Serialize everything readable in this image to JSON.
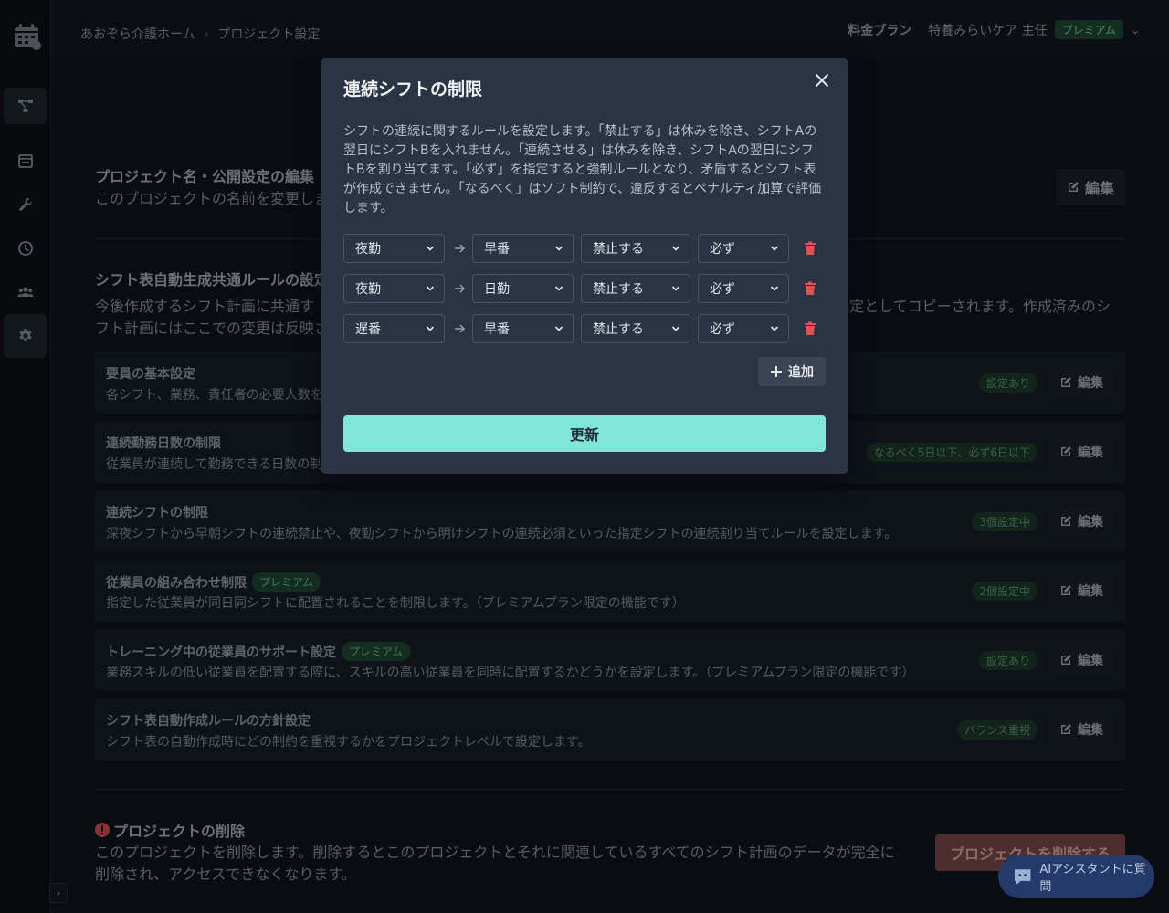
{
  "header": {
    "breadcrumb": [
      "あおぞら介護ホーム",
      "プロジェクト設定"
    ],
    "plan_link": "料金プラン",
    "user_name": "特養みらいケア 主任",
    "user_badge": "プレミアム"
  },
  "sidebar": {
    "items": [
      {
        "icon": "workflow-icon"
      },
      {
        "icon": "calendar-icon"
      },
      {
        "icon": "wrench-icon"
      },
      {
        "icon": "clock-icon"
      },
      {
        "icon": "users-icon"
      },
      {
        "icon": "gear-icon"
      }
    ],
    "toggle": "›"
  },
  "main": {
    "project_name": {
      "title": "プロジェクト名・公開設定の編集",
      "desc": "このプロジェクトの名前を変更しま",
      "edit": "編集"
    },
    "common_rules": {
      "title": "シフト表自動生成共通ルールの設定",
      "desc_left_1": "今後作成するシフト計画に共通す",
      "desc_right_1": "設定としてコピーされます。作成済みのシ",
      "desc_line_2": "フト計画にはここでの変更は反映さ"
    },
    "rules": [
      {
        "title": "要員の基本設定",
        "desc": "各シフト、業務、責任者の必要人数を",
        "status": "設定あり",
        "edit": "編集",
        "premium": ""
      },
      {
        "title": "連続勤務日数の制限",
        "desc": "従業員が連続して勤務できる日数の制",
        "status": "なるべく5日以下、必ず6日以下",
        "edit": "編集",
        "premium": ""
      },
      {
        "title": "連続シフトの制限",
        "desc": "深夜シフトから早朝シフトの連続禁止や、夜勤シフトから明けシフトの連続必須といった指定シフトの連続割り当てルールを設定します。",
        "status": "3個設定中",
        "edit": "編集",
        "premium": ""
      },
      {
        "title": "従業員の組み合わせ制限",
        "desc": "指定した従業員が同日同シフトに配置されることを制限します。（プレミアムプラン限定の機能です）",
        "status": "2個設定中",
        "edit": "編集",
        "premium": "プレミアム"
      },
      {
        "title": "トレーニング中の従業員のサポート設定",
        "desc": "業務スキルの低い従業員を配置する際に、スキルの高い従業員を同時に配置するかどうかを設定します。（プレミアムプラン限定の機能です）",
        "status": "設定あり",
        "edit": "編集",
        "premium": "プレミアム"
      },
      {
        "title": "シフト表自動作成ルールの方針設定",
        "desc": "シフト表の自動作成時にどの制約を重視するかをプロジェクトレベルで設定します。",
        "status": "バランス重視",
        "edit": "編集",
        "premium": ""
      }
    ],
    "delete": {
      "title": "プロジェクトの削除",
      "desc_1": "このプロジェクトを削除します。削除するとこのプロジェクトとそれに関連しているすべてのシフト計画のデータが完全に",
      "desc_2": "削除され、アクセスできなくなります。",
      "button": "プロジェクトを削除する"
    },
    "ai_assistant": "AIアシスタントに質問"
  },
  "modal": {
    "title": "連続シフトの制限",
    "description": "シフトの連続に関するルールを設定します。「禁止する」は休みを除き、シフトAの翌日にシフトBを入れません。「連続させる」は休みを除き、シフトAの翌日にシフトBを割り当てます。「必ず」を指定すると強制ルールとなり、矛盾するとシフト表が作成できません。「なるべく」はソフト制約で、違反するとペナルティ加算で評価します。",
    "rows": [
      {
        "from": "夜勤",
        "to": "早番",
        "action": "禁止する",
        "strength": "必ず"
      },
      {
        "from": "夜勤",
        "to": "日勤",
        "action": "禁止する",
        "strength": "必ず"
      },
      {
        "from": "遅番",
        "to": "早番",
        "action": "禁止する",
        "strength": "必ず"
      }
    ],
    "add_label": "追加",
    "submit_label": "更新"
  },
  "colors": {
    "accent": "#81e6d9",
    "premium": "#1f4a35",
    "danger": "#e05252",
    "modal_bg": "#2b3444"
  }
}
